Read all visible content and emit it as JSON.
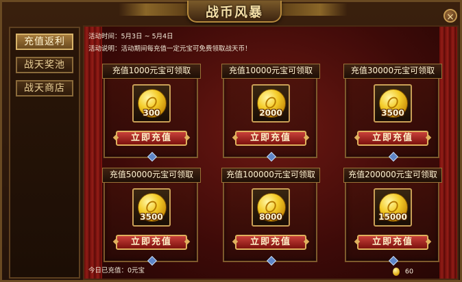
{
  "title": "战币风暴",
  "close_icon": "×",
  "sidebar": {
    "items": [
      {
        "label": "充值返利",
        "active": true
      },
      {
        "label": "战天奖池",
        "active": false
      },
      {
        "label": "战天商店",
        "active": false
      }
    ]
  },
  "info": {
    "time": "活动时间：5月3日 ~ 5月4日",
    "desc": "活动说明：活动期间每充值一定元宝可免费领取战天币！"
  },
  "cards": [
    {
      "title": "充值1000元宝可领取",
      "amount": "300",
      "button": "立即充值"
    },
    {
      "title": "充值10000元宝可领取",
      "amount": "2000",
      "button": "立即充值"
    },
    {
      "title": "充值30000元宝可领取",
      "amount": "3500",
      "button": "立即充值"
    },
    {
      "title": "充值50000元宝可领取",
      "amount": "3500",
      "button": "立即充值"
    },
    {
      "title": "充值100000元宝可领取",
      "amount": "8000",
      "button": "立即充值"
    },
    {
      "title": "充值200000元宝可领取",
      "amount": "15000",
      "button": "立即充值"
    }
  ],
  "footer": {
    "today_recharged": "今日已充值：0元宝",
    "coin_balance": "60"
  },
  "colors": {
    "accent_gold": "#e0b25e",
    "button_red": "#a52a22",
    "panel_red": "#6c1812"
  }
}
